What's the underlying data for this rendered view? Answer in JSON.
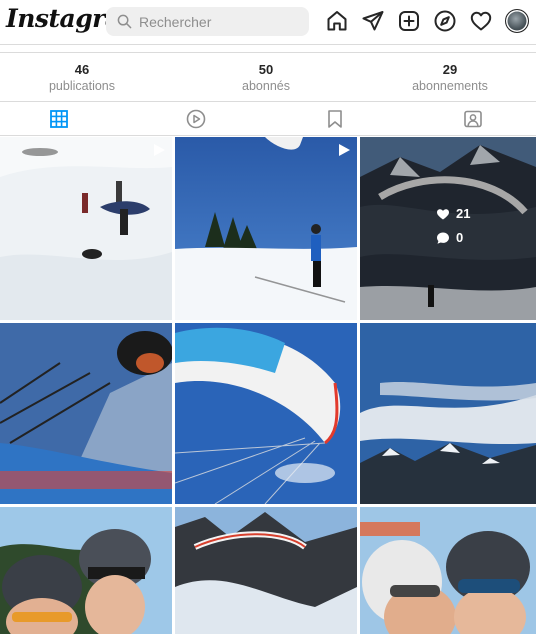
{
  "header": {
    "logo_text": "Instagram",
    "search": {
      "placeholder": "Rechercher",
      "value": ""
    },
    "icons": [
      "home-icon",
      "direct-message-icon",
      "new-post-icon",
      "explore-icon",
      "activity-heart-icon",
      "profile-avatar"
    ]
  },
  "stats": [
    {
      "count": "46",
      "label": "publications"
    },
    {
      "count": "50",
      "label": "abonnés"
    },
    {
      "count": "29",
      "label": "abonnements"
    }
  ],
  "tabs": [
    {
      "name": "posts",
      "icon": "grid-icon",
      "active": true
    },
    {
      "name": "reels",
      "icon": "reels-play-icon",
      "active": false
    },
    {
      "name": "saved",
      "icon": "bookmark-icon",
      "active": false
    },
    {
      "name": "tagged",
      "icon": "tagged-icon",
      "active": false
    }
  ],
  "grid": {
    "posts": [
      {
        "subject": "skiers on snow slope",
        "is_video": true
      },
      {
        "subject": "paraglider pilot on snow",
        "is_video": true
      },
      {
        "subject": "paraglider over mountains",
        "is_video": false,
        "hovered": true,
        "likes": "21",
        "comments": "0"
      },
      {
        "subject": "paraglider lines selfie",
        "is_video": false
      },
      {
        "subject": "paraglider wing from below",
        "is_video": false
      },
      {
        "subject": "snowy mountain range",
        "is_video": false
      },
      {
        "subject": "selfie with helmets",
        "is_video": false
      },
      {
        "subject": "glider over rocky peaks",
        "is_video": false
      },
      {
        "subject": "selfie with helmets close",
        "is_video": false
      }
    ]
  },
  "colors": {
    "accent_blue": "#0095f6",
    "text": "#262626",
    "muted": "#8e8e8e",
    "border": "#dbdbdb"
  }
}
